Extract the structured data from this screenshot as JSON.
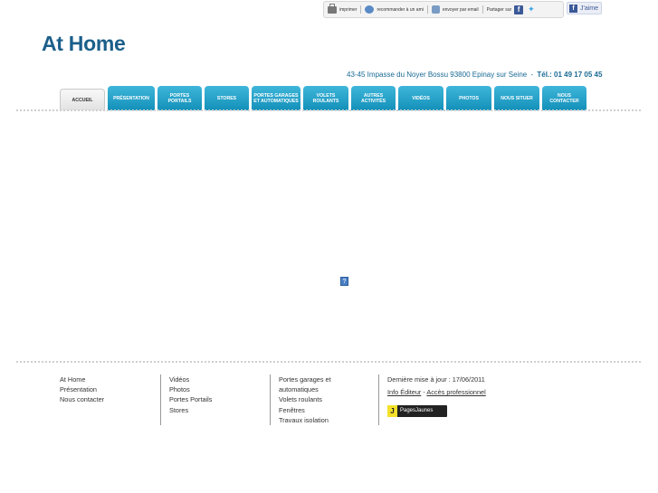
{
  "toolbar": {
    "print": "imprimer",
    "recommend": "recommander à un ami",
    "send": "envoyer par email",
    "share": "Partager sur",
    "like": "J'aime"
  },
  "site": {
    "title": "At Home",
    "address": "43-45 Impasse du Noyer Bossu 93800 Epinay sur Seine",
    "separator": "-",
    "tel": "Tél.: 01 49 17 05 45"
  },
  "nav": [
    {
      "label": "ACCUEIL",
      "active": true
    },
    {
      "label": "PRÉSENTATION"
    },
    {
      "label": "PORTES PORTAILS"
    },
    {
      "label": "STORES"
    },
    {
      "label": "PORTES GARAGES ET AUTOMATIQUES"
    },
    {
      "label": "VOLETS ROULANTS"
    },
    {
      "label": "AUTRES ACTIVITÉS"
    },
    {
      "label": "VIDÉOS"
    },
    {
      "label": "PHOTOS"
    },
    {
      "label": "NOUS SITUER"
    },
    {
      "label": "NOUS CONTACTER"
    }
  ],
  "broken_image": "?",
  "footer": {
    "col1": [
      "At Home",
      "Présentation",
      "Nous contacter"
    ],
    "col2": [
      "Vidéos",
      "Photos",
      "Portes Portails",
      "Stores"
    ],
    "col3": [
      "Portes garages et",
      "automatiques",
      "Volets roulants",
      "Fenêtres",
      "Travaux isolation"
    ],
    "updated": "Dernière mise à jour : 17/06/2011",
    "info_editeur": "Info Éditeur",
    "dash": "-",
    "acces_pro": "Accès professionnel",
    "pj_letter": "J",
    "pj_label": "PagesJaunes"
  },
  "colors": {
    "brand": "#1b5f8a",
    "tab": "#169ec7"
  }
}
